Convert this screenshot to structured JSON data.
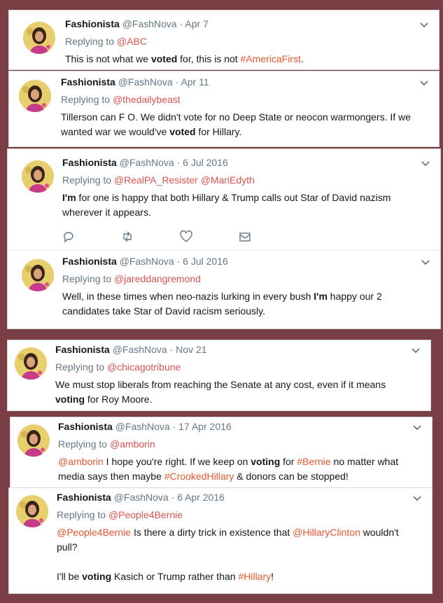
{
  "user": {
    "name": "Fashionista",
    "handle": "@FashNova",
    "sep": "·"
  },
  "reply_prefix": "Replying to",
  "tweets": [
    {
      "date": "Apr 7",
      "reply_to": [
        "@ABC"
      ],
      "lines": [
        [
          {
            "t": "This is not what we "
          },
          {
            "t": "voted",
            "b": true
          },
          {
            "t": " for, this is not "
          },
          {
            "t": "#AmericaFirst",
            "l": true
          },
          {
            "t": "."
          }
        ]
      ]
    },
    {
      "date": "Apr 11",
      "reply_to": [
        "@thedailybeast"
      ],
      "lines": [
        [
          {
            "t": "Tillerson can F O. We didn't vote for no Deep State or neocon warmongers. If we"
          }
        ],
        [
          {
            "t": "wanted war we would've "
          },
          {
            "t": "voted",
            "b": true
          },
          {
            "t": " for Hillary."
          }
        ]
      ]
    },
    {
      "date": "6 Jul 2016",
      "reply_to": [
        "@RealPA_Resister",
        "@MariEdyth"
      ],
      "lines": [
        [
          {
            "t": "I'm",
            "b": true
          },
          {
            "t": " for one is happy that both Hillary & Trump calls out Star of David nazism"
          }
        ],
        [
          {
            "t": "wherever it appears."
          }
        ]
      ]
    },
    {
      "date": "6 Jul 2016",
      "reply_to": [
        "@jareddangremond"
      ],
      "lines": [
        [
          {
            "t": "Well, in these times when neo-nazis lurking in every bush "
          },
          {
            "t": "I'm",
            "b": true
          },
          {
            "t": " happy our 2"
          }
        ],
        [
          {
            "t": "candidates take Star of David racism seriously."
          }
        ]
      ]
    },
    {
      "date": "Nov 21",
      "reply_to": [
        "@chicagotribune"
      ],
      "lines": [
        [
          {
            "t": "We must stop liberals from reaching the Senate at any cost, even if it means"
          }
        ],
        [
          {
            "t": "voting",
            "b": true
          },
          {
            "t": " for Roy Moore."
          }
        ]
      ]
    },
    {
      "date": "17 Apr 2016",
      "reply_to": [
        "@amborin"
      ],
      "lines": [
        [
          {
            "t": "@amborin",
            "l": true
          },
          {
            "t": " I hope you're right. If we keep on "
          },
          {
            "t": "voting",
            "b": true
          },
          {
            "t": " for "
          },
          {
            "t": "#Bernie",
            "l": true
          },
          {
            "t": " no matter what"
          }
        ],
        [
          {
            "t": "media says then maybe "
          },
          {
            "t": "#CrookedHillary",
            "l": true
          },
          {
            "t": " & donors can be stopped!"
          }
        ]
      ]
    },
    {
      "date": "6 Apr 2016",
      "reply_to": [
        "@People4Bernie"
      ],
      "lines": [
        [
          {
            "t": "@People4Bernie",
            "l": true
          },
          {
            "t": " Is there a dirty trick in existence that "
          },
          {
            "t": "@HillaryClinton",
            "l": true
          },
          {
            "t": " wouldn't"
          }
        ],
        [
          {
            "t": "pull?"
          }
        ],
        [
          {
            "t": ""
          }
        ],
        [
          {
            "t": "I'll be "
          },
          {
            "t": "voting",
            "b": true
          },
          {
            "t": " Kasich or Trump rather than "
          },
          {
            "t": "#Hillary",
            "l": true
          },
          {
            "t": "!"
          }
        ]
      ]
    }
  ],
  "colors": {
    "background": "#7a3f45",
    "link": "#e8572f",
    "muted": "#657786"
  },
  "icons": [
    "reply-icon",
    "retweet-icon",
    "like-icon",
    "message-icon",
    "chevron-down-icon"
  ]
}
